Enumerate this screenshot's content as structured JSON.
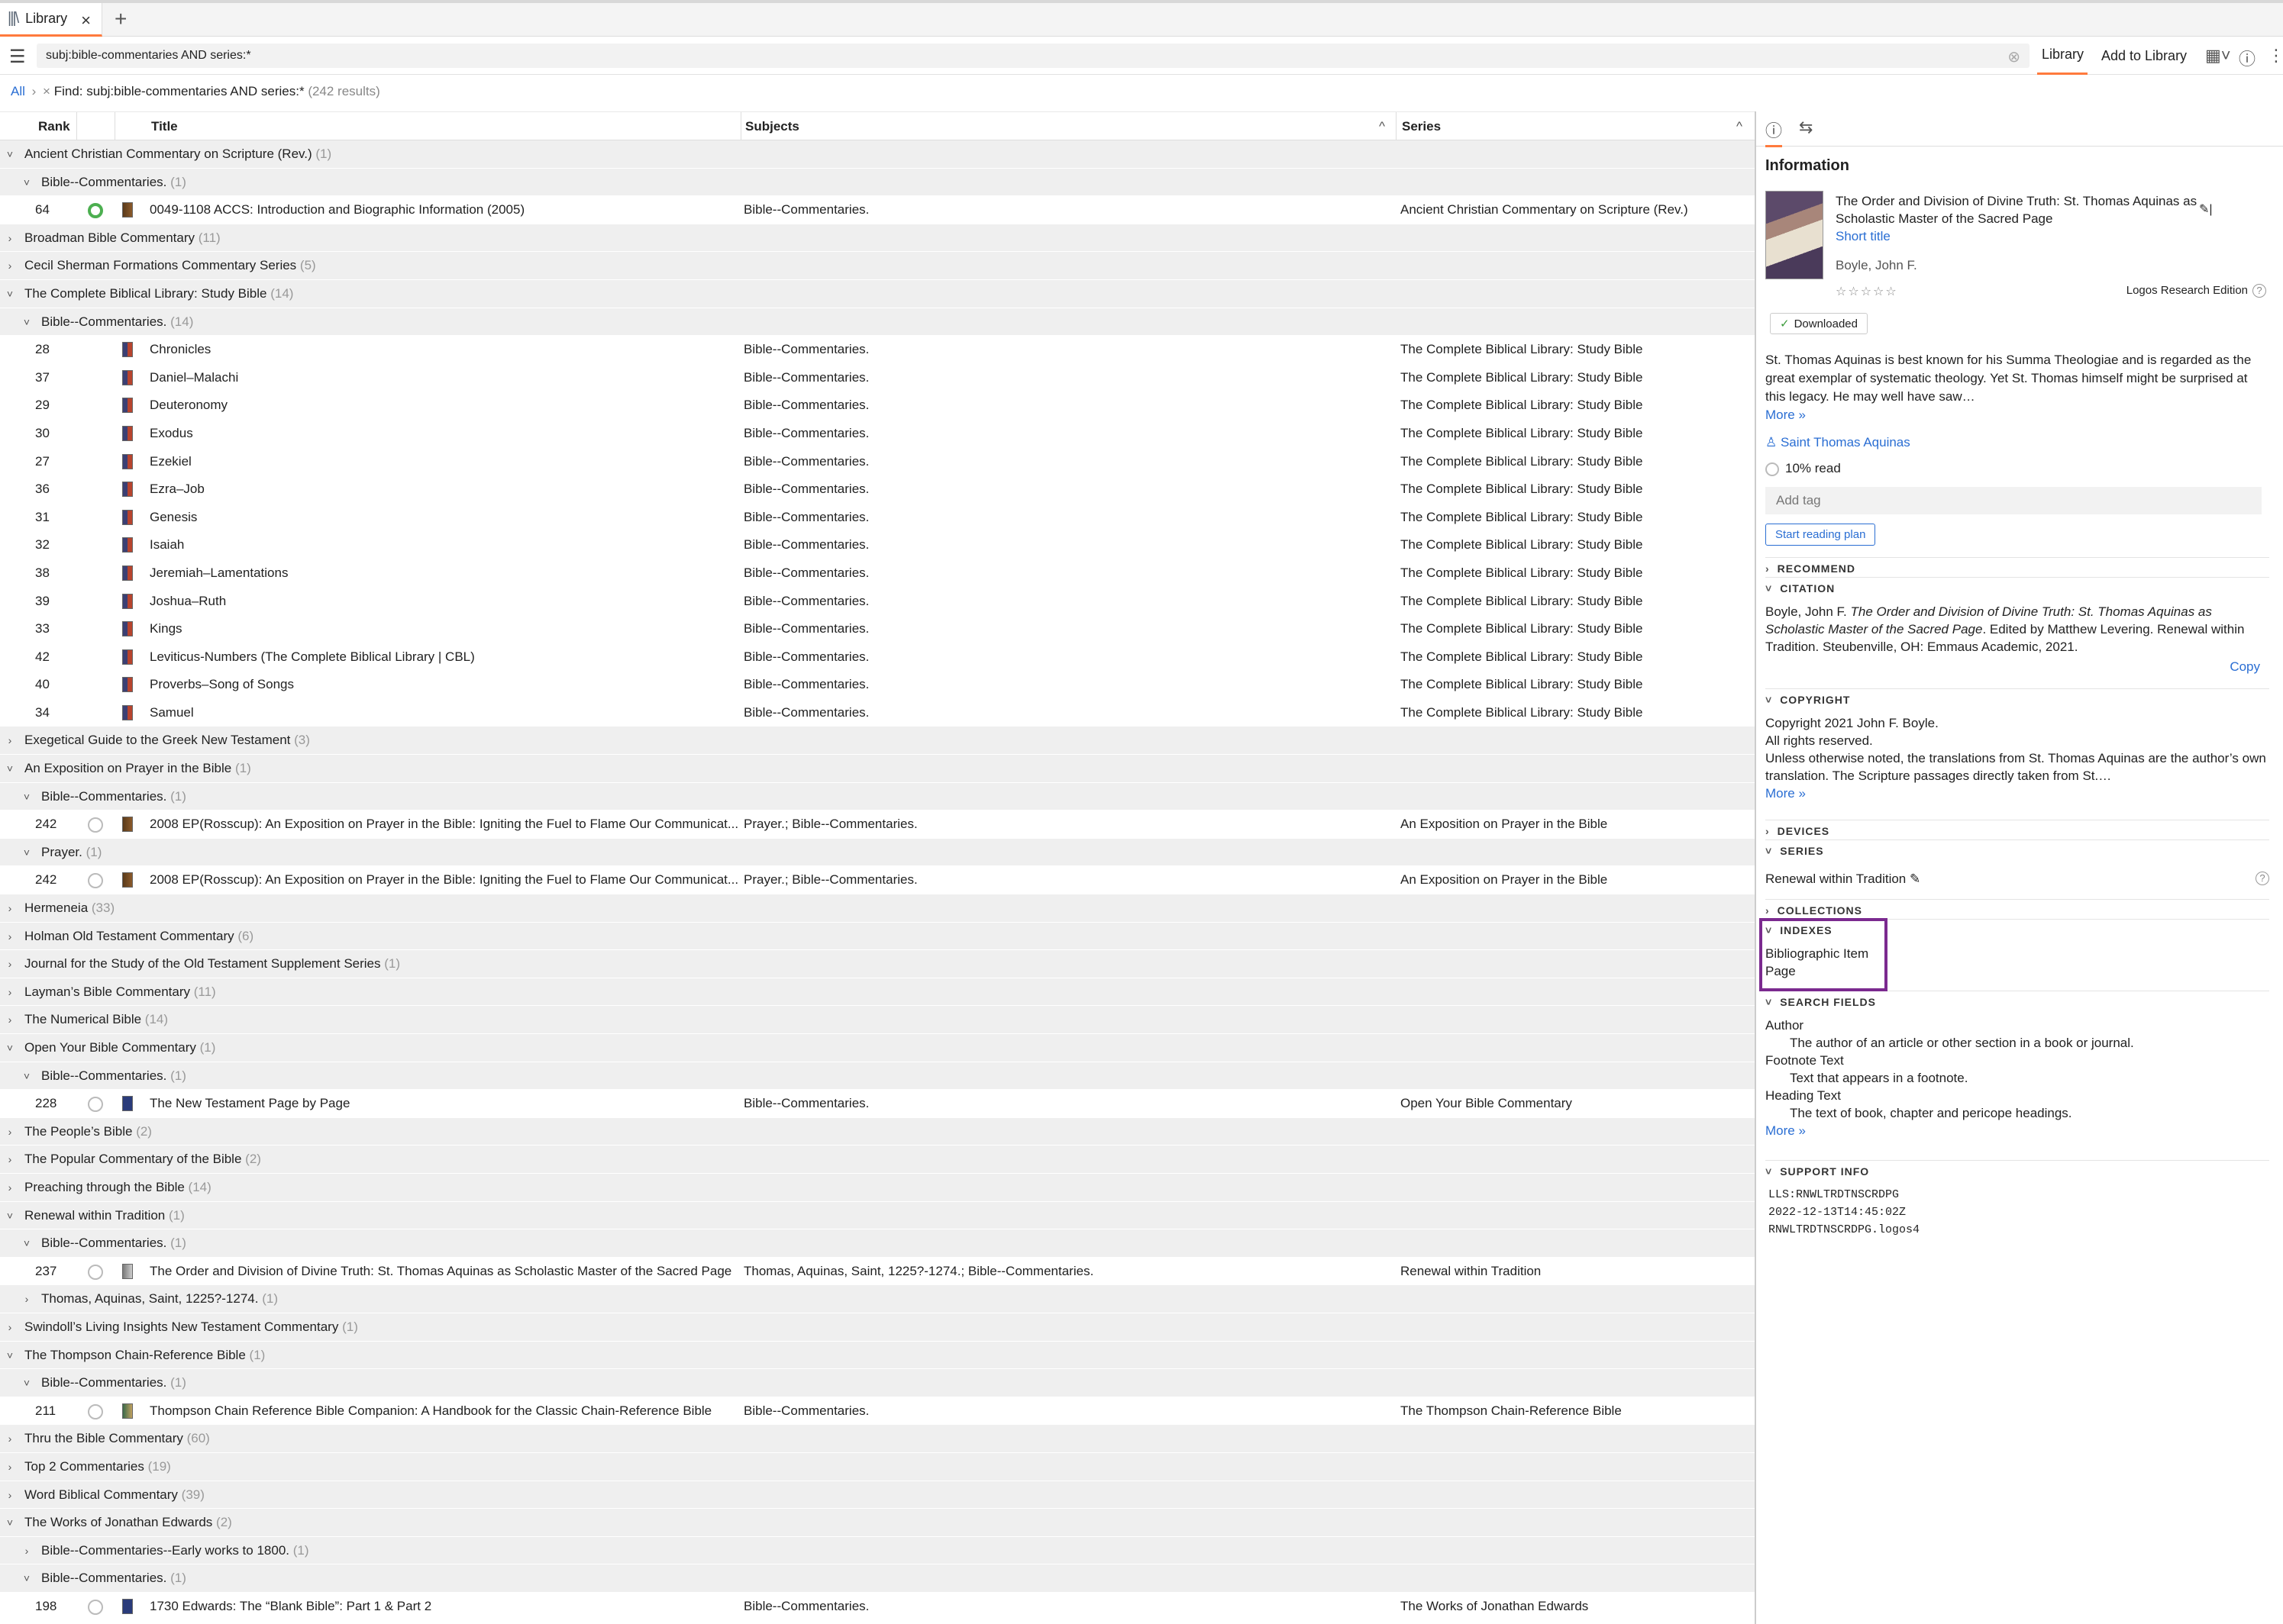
{
  "tab": {
    "label": "Library",
    "icon": "library-icon"
  },
  "toolbar": {
    "search_value": "subj:bible-commentaries AND series:*",
    "library_btn": "Library",
    "add_btn": "Add to Library"
  },
  "breadcrumb": {
    "all": "All",
    "find": "Find: subj:bible-commentaries AND series:*",
    "results": "(242 results)"
  },
  "columns": {
    "rank": "Rank",
    "title": "Title",
    "subjects": "Subjects",
    "series": "Series"
  },
  "rows": [
    {
      "type": "group",
      "open": true,
      "title": "Ancient Christian Commentary on Scripture (Rev.)",
      "count": "(1)"
    },
    {
      "type": "sub",
      "open": true,
      "title": "Bible--Commentaries.",
      "count": "(1)"
    },
    {
      "type": "item",
      "rank": "64",
      "status": "done",
      "cover": "brown",
      "title": "0049-1108 ACCS: Introduction and Biographic Information (2005)",
      "subjects": "Bible--Commentaries.",
      "series": "Ancient Christian Commentary on Scripture (Rev.)"
    },
    {
      "type": "group",
      "open": false,
      "title": "Broadman Bible Commentary",
      "count": "(11)"
    },
    {
      "type": "group",
      "open": false,
      "title": "Cecil Sherman Formations Commentary Series",
      "count": "(5)"
    },
    {
      "type": "group",
      "open": true,
      "title": "The Complete Biblical Library: Study Bible",
      "count": "(14)"
    },
    {
      "type": "sub",
      "open": true,
      "title": "Bible--Commentaries.",
      "count": "(14)"
    },
    {
      "type": "item",
      "rank": "28",
      "status": "none",
      "cover": "std",
      "title": "Chronicles",
      "subjects": "Bible--Commentaries.",
      "series": "The Complete Biblical Library: Study Bible"
    },
    {
      "type": "item",
      "rank": "37",
      "status": "none",
      "cover": "std",
      "title": "Daniel–Malachi",
      "subjects": "Bible--Commentaries.",
      "series": "The Complete Biblical Library: Study Bible"
    },
    {
      "type": "item",
      "rank": "29",
      "status": "none",
      "cover": "std",
      "title": "Deuteronomy",
      "subjects": "Bible--Commentaries.",
      "series": "The Complete Biblical Library: Study Bible"
    },
    {
      "type": "item",
      "rank": "30",
      "status": "none",
      "cover": "std",
      "title": "Exodus",
      "subjects": "Bible--Commentaries.",
      "series": "The Complete Biblical Library: Study Bible"
    },
    {
      "type": "item",
      "rank": "27",
      "status": "none",
      "cover": "std",
      "title": "Ezekiel",
      "subjects": "Bible--Commentaries.",
      "series": "The Complete Biblical Library: Study Bible"
    },
    {
      "type": "item",
      "rank": "36",
      "status": "none",
      "cover": "std",
      "title": "Ezra–Job",
      "subjects": "Bible--Commentaries.",
      "series": "The Complete Biblical Library: Study Bible"
    },
    {
      "type": "item",
      "rank": "31",
      "status": "none",
      "cover": "std",
      "title": "Genesis",
      "subjects": "Bible--Commentaries.",
      "series": "The Complete Biblical Library: Study Bible"
    },
    {
      "type": "item",
      "rank": "32",
      "status": "none",
      "cover": "std",
      "title": "Isaiah",
      "subjects": "Bible--Commentaries.",
      "series": "The Complete Biblical Library: Study Bible"
    },
    {
      "type": "item",
      "rank": "38",
      "status": "none",
      "cover": "std",
      "title": "Jeremiah–Lamentations",
      "subjects": "Bible--Commentaries.",
      "series": "The Complete Biblical Library: Study Bible"
    },
    {
      "type": "item",
      "rank": "39",
      "status": "none",
      "cover": "std",
      "title": "Joshua–Ruth",
      "subjects": "Bible--Commentaries.",
      "series": "The Complete Biblical Library: Study Bible"
    },
    {
      "type": "item",
      "rank": "33",
      "status": "none",
      "cover": "std",
      "title": "Kings",
      "subjects": "Bible--Commentaries.",
      "series": "The Complete Biblical Library: Study Bible"
    },
    {
      "type": "item",
      "rank": "42",
      "status": "none",
      "cover": "std",
      "title": "Leviticus-Numbers (The Complete Biblical Library | CBL)",
      "subjects": "Bible--Commentaries.",
      "series": "The Complete Biblical Library: Study Bible"
    },
    {
      "type": "item",
      "rank": "40",
      "status": "none",
      "cover": "std",
      "title": "Proverbs–Song of Songs",
      "subjects": "Bible--Commentaries.",
      "series": "The Complete Biblical Library: Study Bible"
    },
    {
      "type": "item",
      "rank": "34",
      "status": "none",
      "cover": "std",
      "title": "Samuel",
      "subjects": "Bible--Commentaries.",
      "series": "The Complete Biblical Library: Study Bible"
    },
    {
      "type": "group",
      "open": false,
      "title": "Exegetical Guide to the Greek New Testament",
      "count": "(3)"
    },
    {
      "type": "group",
      "open": true,
      "title": "An Exposition on Prayer in the Bible",
      "count": "(1)"
    },
    {
      "type": "sub",
      "open": true,
      "title": "Bible--Commentaries.",
      "count": "(1)"
    },
    {
      "type": "item",
      "rank": "242",
      "status": "empty",
      "cover": "brown",
      "title": "2008 EP(Rosscup): An Exposition on Prayer in the Bible: Igniting the Fuel to Flame Our Communicat...",
      "subjects": "Prayer.; Bible--Commentaries.",
      "series": "An Exposition on Prayer in the Bible"
    },
    {
      "type": "sub",
      "open": true,
      "title": "Prayer.",
      "count": "(1)"
    },
    {
      "type": "item",
      "rank": "242",
      "status": "empty",
      "cover": "brown",
      "title": "2008 EP(Rosscup): An Exposition on Prayer in the Bible: Igniting the Fuel to Flame Our Communicat...",
      "subjects": "Prayer.; Bible--Commentaries.",
      "series": "An Exposition on Prayer in the Bible"
    },
    {
      "type": "group",
      "open": false,
      "title": "Hermeneia",
      "count": "(33)"
    },
    {
      "type": "group",
      "open": false,
      "title": "Holman Old Testament Commentary",
      "count": "(6)"
    },
    {
      "type": "group",
      "open": false,
      "title": "Journal for the Study of the Old Testament Supplement Series",
      "count": "(1)"
    },
    {
      "type": "group",
      "open": false,
      "title": "Layman’s Bible Commentary",
      "count": "(11)"
    },
    {
      "type": "group",
      "open": false,
      "title": "The Numerical Bible",
      "count": "(14)"
    },
    {
      "type": "group",
      "open": true,
      "title": "Open Your Bible Commentary",
      "count": "(1)"
    },
    {
      "type": "sub",
      "open": true,
      "title": "Bible--Commentaries.",
      "count": "(1)"
    },
    {
      "type": "item",
      "rank": "228",
      "status": "empty",
      "cover": "blue",
      "title": "The New Testament Page by Page",
      "subjects": "Bible--Commentaries.",
      "series": "Open Your Bible Commentary"
    },
    {
      "type": "group",
      "open": false,
      "title": "The People’s Bible",
      "count": "(2)"
    },
    {
      "type": "group",
      "open": false,
      "title": "The Popular Commentary of the Bible",
      "count": "(2)"
    },
    {
      "type": "group",
      "open": false,
      "title": "Preaching through the Bible",
      "count": "(14)"
    },
    {
      "type": "group",
      "open": true,
      "title": "Renewal within Tradition",
      "count": "(1)"
    },
    {
      "type": "sub",
      "open": true,
      "title": "Bible--Commentaries.",
      "count": "(1)"
    },
    {
      "type": "item",
      "rank": "237",
      "status": "progress",
      "cover": "grey",
      "title": "The Order and Division of Divine Truth: St. Thomas Aquinas as Scholastic Master of the Sacred Page",
      "subjects": "Thomas, Aquinas, Saint, 1225?-1274.; Bible--Commentaries.",
      "series": "Renewal within Tradition"
    },
    {
      "type": "sub",
      "open": false,
      "title": "Thomas, Aquinas, Saint, 1225?-1274.",
      "count": "(1)"
    },
    {
      "type": "group",
      "open": false,
      "title": "Swindoll’s Living Insights New Testament Commentary",
      "count": "(1)"
    },
    {
      "type": "group",
      "open": true,
      "title": "The Thompson Chain-Reference Bible",
      "count": "(1)"
    },
    {
      "type": "sub",
      "open": true,
      "title": "Bible--Commentaries.",
      "count": "(1)"
    },
    {
      "type": "item",
      "rank": "211",
      "status": "empty",
      "cover": "green",
      "title": "Thompson Chain Reference Bible Companion: A Handbook for the Classic Chain-Reference Bible",
      "subjects": "Bible--Commentaries.",
      "series": "The Thompson Chain-Reference Bible"
    },
    {
      "type": "group",
      "open": false,
      "title": "Thru the Bible Commentary",
      "count": "(60)"
    },
    {
      "type": "group",
      "open": false,
      "title": "Top 2 Commentaries",
      "count": "(19)"
    },
    {
      "type": "group",
      "open": false,
      "title": "Word Biblical Commentary",
      "count": "(39)"
    },
    {
      "type": "group",
      "open": true,
      "title": "The Works of Jonathan Edwards",
      "count": "(2)"
    },
    {
      "type": "sub",
      "open": false,
      "title": "Bible--Commentaries--Early works to 1800.",
      "count": "(1)"
    },
    {
      "type": "sub",
      "open": true,
      "title": "Bible--Commentaries.",
      "count": "(1)"
    },
    {
      "type": "item",
      "rank": "198",
      "status": "empty",
      "cover": "blue",
      "title": "1730 Edwards: The “Blank Bible”: Part 1 & Part 2",
      "subjects": "Bible--Commentaries.",
      "series": "The Works of Jonathan Edwards"
    }
  ],
  "panel": {
    "heading": "Information",
    "book_title": "The Order and Division of Divine Truth: St. Thomas Aquinas as Scholastic Master of the Sacred Page",
    "short_title": "Short title",
    "author": "Boyle, John F.",
    "edition": "Logos Research Edition",
    "downloaded": "Downloaded",
    "description": "St. Thomas Aquinas is best known for his Summa Theologiae and is regarded as the great exemplar of systematic theology. Yet St. Thomas himself might be surprised at this legacy. He may well have saw…",
    "more": "More »",
    "person": "Saint Thomas Aquinas",
    "read": "10% read",
    "add_tag": "Add tag",
    "reading_plan": "Start reading plan",
    "sections": {
      "recommend": "RECOMMEND",
      "citation": "CITATION",
      "copyright": "COPYRIGHT",
      "devices": "DEVICES",
      "series": "SERIES",
      "collections": "COLLECTIONS",
      "indexes": "INDEXES",
      "search_fields": "SEARCH FIELDS",
      "support": "SUPPORT INFO"
    },
    "citation_pre": "Boyle, John F. ",
    "citation_italic": "The Order and Division of Divine Truth: St. Thomas Aquinas as Scholastic Master of the Sacred Page",
    "citation_post": ". Edited by Matthew Levering. Renewal within Tradition. Steubenville, OH: Emmaus Academic, 2021.",
    "copy": "Copy",
    "copyright_1": "Copyright 2021 John F. Boyle.",
    "copyright_2": "All rights reserved.",
    "copyright_3": "Unless otherwise noted, the translations from St. Thomas Aquinas are the author’s own translation. The Scripture passages directly taken from St.…",
    "series_value": "Renewal within Tradition",
    "index_1": "Bibliographic Item",
    "index_2": "Page",
    "sf_1": "Author",
    "sf_1d": "The author of an article or other section in a book or journal.",
    "sf_2": "Footnote Text",
    "sf_2d": "Text that appears in a footnote.",
    "sf_3": "Heading Text",
    "sf_3d": "The text of book, chapter and pericope headings.",
    "support_1": "LLS:RNWLTRDTNSCRDPG",
    "support_2": "2022-12-13T14:45:02Z",
    "support_3": "RNWLTRDTNSCRDPG.logos4"
  }
}
